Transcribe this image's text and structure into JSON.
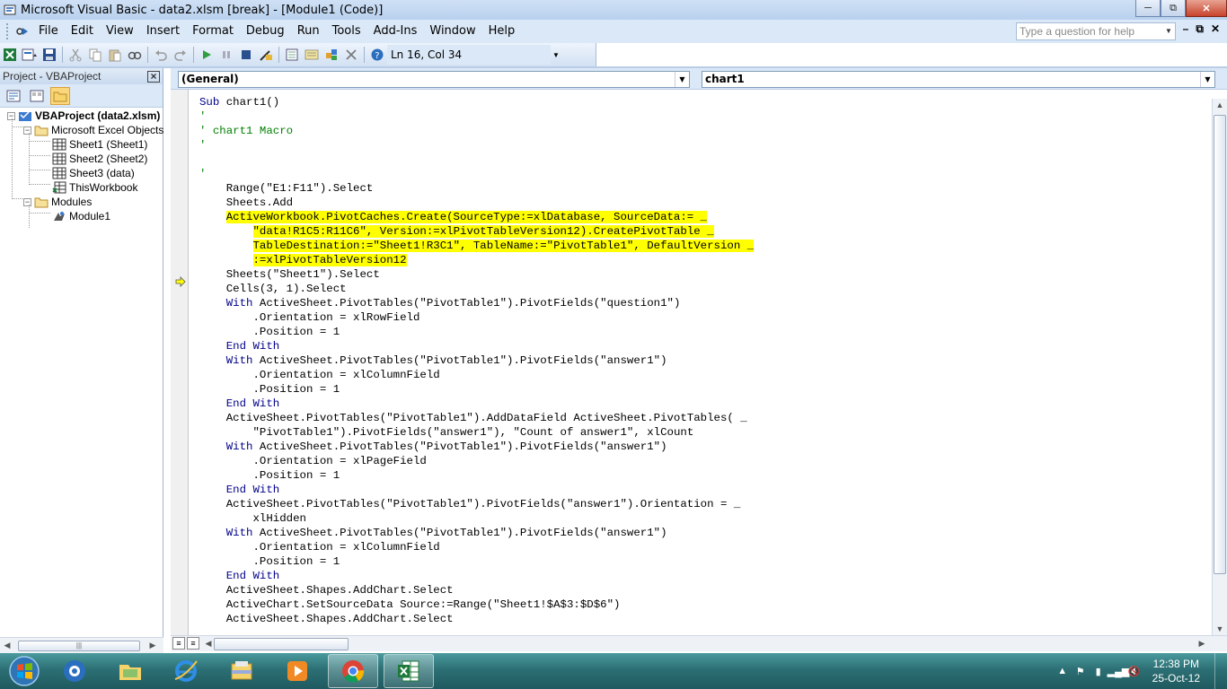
{
  "window": {
    "title": "Microsoft Visual Basic - data2.xlsm [break] - [Module1 (Code)]",
    "minimize_icon": "minimize-icon",
    "maximize_icon": "restore-icon",
    "close_icon": "close-icon"
  },
  "menu": {
    "items": [
      "File",
      "Edit",
      "View",
      "Insert",
      "Format",
      "Debug",
      "Run",
      "Tools",
      "Add-Ins",
      "Window",
      "Help"
    ],
    "help_placeholder": "Type a question for help"
  },
  "toolbar": {
    "cursor_position": "Ln 16, Col 34"
  },
  "project": {
    "title": "Project - VBAProject",
    "close": "×",
    "tree": [
      {
        "label": "VBAProject (data2.xlsm)",
        "level": "root",
        "icon": "vba-project-icon"
      },
      {
        "label": "Microsoft Excel Objects",
        "level": "folder",
        "icon": "folder-icon"
      },
      {
        "label": "Sheet1 (Sheet1)",
        "level": "item",
        "icon": "worksheet-icon"
      },
      {
        "label": "Sheet2 (Sheet2)",
        "level": "item",
        "icon": "worksheet-icon"
      },
      {
        "label": "Sheet3 (data)",
        "level": "item",
        "icon": "worksheet-icon"
      },
      {
        "label": "ThisWorkbook",
        "level": "item",
        "icon": "workbook-icon"
      },
      {
        "label": "Modules",
        "level": "folder",
        "icon": "folder-icon"
      },
      {
        "label": "Module1",
        "level": "item",
        "icon": "module-icon"
      }
    ]
  },
  "code": {
    "object_combo": "(General)",
    "procedure_combo": "chart1",
    "lines": [
      "Sub chart1()",
      "'",
      "' chart1 Macro",
      "'",
      "",
      "'",
      "    Range(\"E1:F11\").Select",
      "    Sheets.Add",
      "    ActiveWorkbook.PivotCaches.Create(SourceType:=xlDatabase, SourceData:= _",
      "        \"data!R1C5:R11C6\", Version:=xlPivotTableVersion12).CreatePivotTable _",
      "        TableDestination:=\"Sheet1!R3C1\", TableName:=\"PivotTable1\", DefaultVersion _",
      "        :=xlPivotTableVersion12",
      "    Sheets(\"Sheet1\").Select",
      "    Cells(3, 1).Select",
      "    With ActiveSheet.PivotTables(\"PivotTable1\").PivotFields(\"question1\")",
      "        .Orientation = xlRowField",
      "        .Position = 1",
      "    End With",
      "    With ActiveSheet.PivotTables(\"PivotTable1\").PivotFields(\"answer1\")",
      "        .Orientation = xlColumnField",
      "        .Position = 1",
      "    End With",
      "    ActiveSheet.PivotTables(\"PivotTable1\").AddDataField ActiveSheet.PivotTables( _",
      "        \"PivotTable1\").PivotFields(\"answer1\"), \"Count of answer1\", xlCount",
      "    With ActiveSheet.PivotTables(\"PivotTable1\").PivotFields(\"answer1\")",
      "        .Orientation = xlPageField",
      "        .Position = 1",
      "    End With",
      "    ActiveSheet.PivotTables(\"PivotTable1\").PivotFields(\"answer1\").Orientation = _",
      "        xlHidden",
      "    With ActiveSheet.PivotTables(\"PivotTable1\").PivotFields(\"answer1\")",
      "        .Orientation = xlColumnField",
      "        .Position = 1",
      "    End With",
      "    ActiveSheet.Shapes.AddChart.Select",
      "    ActiveChart.SetSourceData Source:=Range(\"Sheet1!$A$3:$D$6\")",
      "    ActiveSheet.Shapes.AddChart.Select"
    ],
    "highlight_color": "#ffff00",
    "keyword_color": "#00008b",
    "comment_color": "#008000"
  },
  "taskbar": {
    "apps": [
      "windows-start-icon",
      "outlook-icon",
      "folder-icon",
      "internet-explorer-icon",
      "explorer-icon",
      "media-player-icon",
      "chrome-icon",
      "excel-icon"
    ],
    "time": "12:38 PM",
    "date": "25-Oct-12"
  }
}
